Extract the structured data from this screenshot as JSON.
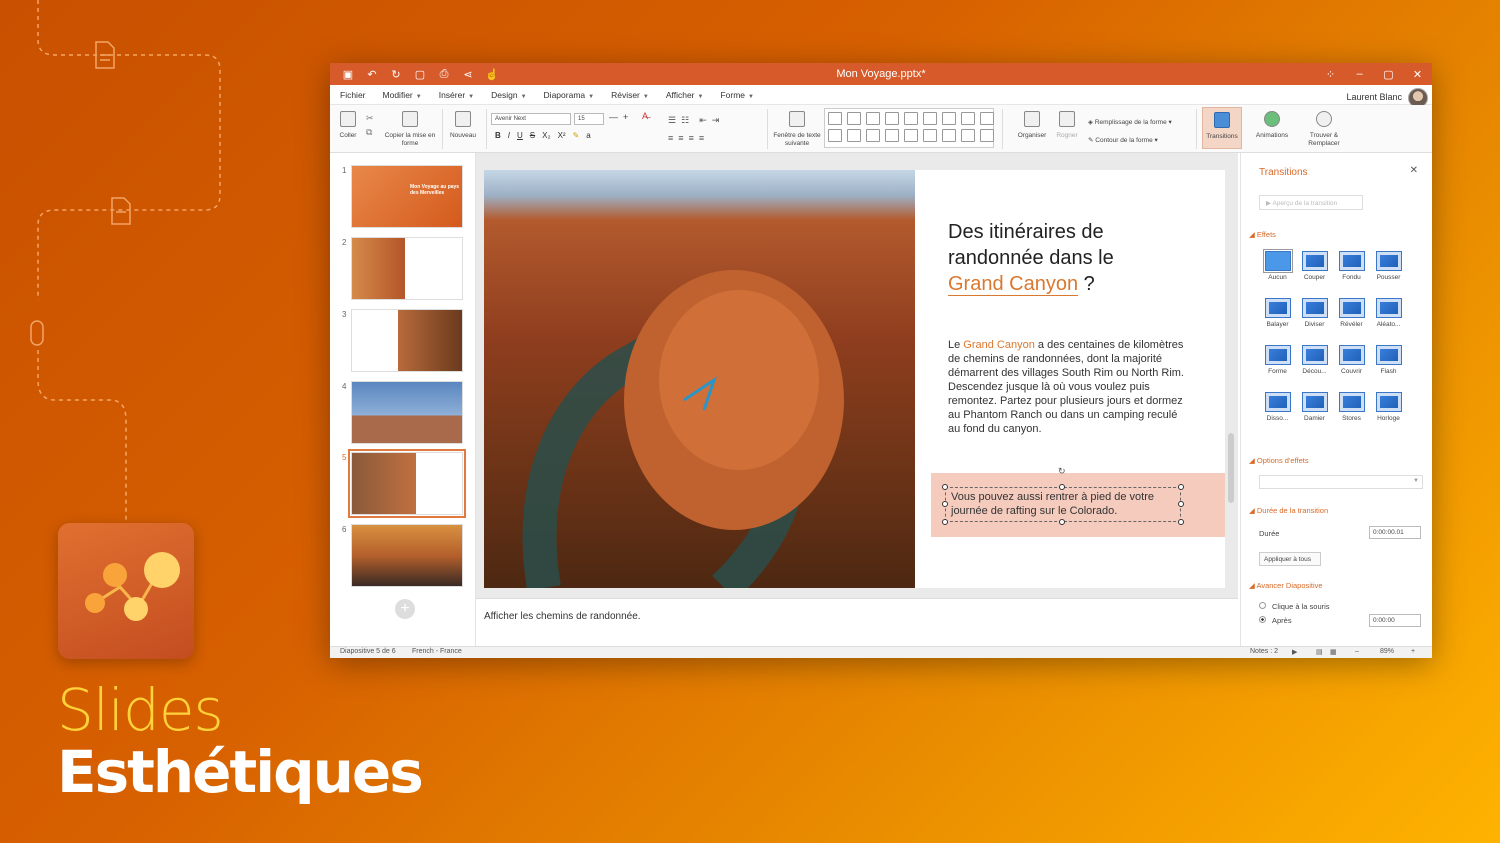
{
  "window": {
    "title": "Mon Voyage.pptx*",
    "quick_access": [
      "save-icon",
      "undo-icon",
      "redo-icon",
      "new-file-icon",
      "print-icon",
      "share-icon",
      "touch-icon"
    ]
  },
  "menu": {
    "items": [
      "Fichier",
      "Modifier",
      "Insérer",
      "Design",
      "Diaporama",
      "Réviser",
      "Afficher",
      "Forme"
    ],
    "user_name": "Laurent Blanc"
  },
  "ribbon": {
    "paste": "Coller",
    "format_painter": "Copier la mise en forme",
    "new_slide": "Nouveau",
    "font_name": "Avenir Next",
    "font_size": "15",
    "text_window": "Fenêtre de texte suivante",
    "arrange": "Organiser",
    "crop": "Rogner",
    "shape_fill": "Remplissage de la forme",
    "shape_outline": "Contour de la forme",
    "transitions": "Transitions",
    "animations": "Animations",
    "find_replace": "Trouver & Remplacer",
    "format_tools": [
      "B",
      "I",
      "U",
      "S",
      "X₂",
      "X²"
    ]
  },
  "thumbnails": [
    {
      "num": "1",
      "title": "Mon Voyage au pays des Merveilles",
      "colors": [
        "#e8884a",
        "#d45a1c"
      ]
    },
    {
      "num": "2",
      "title": "",
      "colors": [
        "#d58a4a",
        "#b4562a"
      ]
    },
    {
      "num": "3",
      "title": "",
      "colors": [
        "#b86a3a",
        "#6a3a1e"
      ]
    },
    {
      "num": "4",
      "title": "",
      "colors": [
        "#5a86c0",
        "#a86a4a"
      ]
    },
    {
      "num": "5",
      "title": "",
      "colors": [
        "#8a5a3a",
        "#c07040"
      ]
    },
    {
      "num": "6",
      "title": "",
      "colors": [
        "#d89040",
        "#3a2a24"
      ]
    }
  ],
  "slide": {
    "title_line1": "Des itinéraires de",
    "title_line2": "randonnée dans le",
    "title_accent": "Grand Canyon",
    "title_end": " ?",
    "body_pre": "Le ",
    "body_accent": "Grand Canyon",
    "body_post": " a des centaines de kilomètres de chemins de randonnées, dont la majorité démarrent des villages South Rim ou North Rim. Descendez jusque là où vous voulez puis remontez. Partez pour plusieurs jours et dormez au Phantom Ranch ou dans un camping reculé au fond du canyon.",
    "callout": "Vous pouvez aussi rentrer à pied de votre journée de rafting sur le Colorado."
  },
  "notes": "Afficher les chemins de randonnée.",
  "transitions_pane": {
    "title": "Transitions",
    "preview_button": "Aperçu de la transition",
    "effects_label": "Effets",
    "effects": [
      "Aucun",
      "Couper",
      "Fondu",
      "Pousser",
      "Balayer",
      "Diviser",
      "Révéler",
      "Aléato...",
      "Forme",
      "Décou...",
      "Couvrir",
      "Flash",
      "Disso...",
      "Damier",
      "Stores",
      "Horloge"
    ],
    "effect_options_label": "Options d'effets",
    "duration_section": "Durée de la transition",
    "duration_label": "Durée",
    "duration_value": "0:00:00.01",
    "apply_all": "Appliquer à tous",
    "advance_section": "Avancer Diapositive",
    "on_click": "Clique à la souris",
    "after": "Après",
    "after_value": "0:00:00"
  },
  "status": {
    "slide_pos": "Diapositive 5 de 6",
    "language": "French - France",
    "notes_count": "Notes : 2",
    "zoom": "89%"
  },
  "promo": {
    "line1": "Slides",
    "line2": "Esthétiques"
  },
  "colors": {
    "accent": "#d9782f",
    "titlebar": "#d75a2a",
    "effect_blue": "#2f74d0"
  }
}
